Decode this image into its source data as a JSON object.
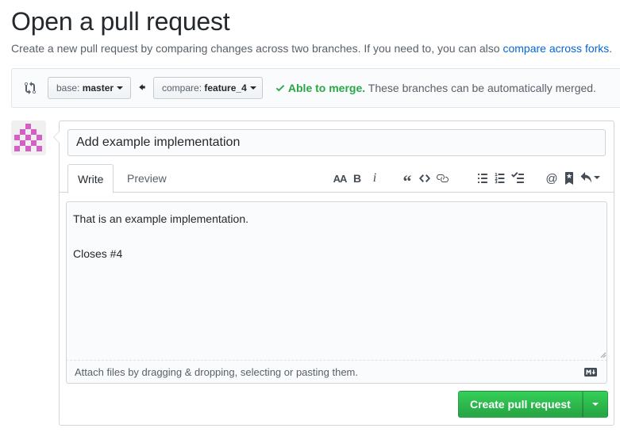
{
  "header": {
    "title": "Open a pull request",
    "subtitle": "Create a new pull request by comparing changes across two branches. If you need to, you can also",
    "compare_forks_link": "compare across forks",
    "subtitle_end": "."
  },
  "range": {
    "base_prefix": "base:",
    "base_branch": "master",
    "compare_prefix": "compare:",
    "compare_branch": "feature_4",
    "merge_ok": "Able to merge.",
    "merge_text": "These branches can be automatically merged."
  },
  "form": {
    "title_value": "Add example implementation",
    "tabs": [
      "Write",
      "Preview"
    ],
    "body_value": "That is an example implementation.\n\nCloses #4",
    "attach_text": "Attach files by dragging & dropping, selecting or pasting them.",
    "submit_label": "Create pull request",
    "toolbar": {
      "header_glyph": "AA",
      "bold_glyph": "B",
      "italic_glyph": "i",
      "quote_glyph": "“",
      "mention_glyph": "@"
    }
  },
  "colors": {
    "link": "#0366d6",
    "success": "#28a745",
    "avatar": "#d65fc6"
  }
}
